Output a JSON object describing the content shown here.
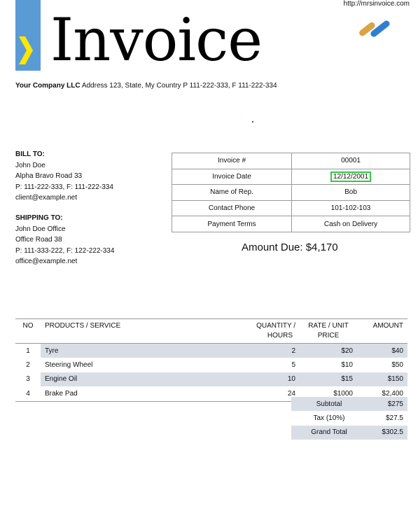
{
  "header": {
    "title": "Invoice",
    "url": "http://mrsinvoice.com",
    "company_name": "Your Company LLC",
    "company_details": "Address 123, State, My Country P 111-222-333, F 111-222-334"
  },
  "bill_to": {
    "heading": "BILL TO:",
    "name": "John Doe",
    "address": "Alpha Bravo Road 33",
    "phone": "P: 111-222-333, F: 111-222-334",
    "email": "client@example.net"
  },
  "ship_to": {
    "heading": "SHIPPING TO:",
    "name": "John Doe Office",
    "address": "Office Road 38",
    "phone": "P: 111-333-222, F: 122-222-334",
    "email": "office@example.net"
  },
  "info": [
    {
      "label": "Invoice #",
      "value": "00001"
    },
    {
      "label": "Invoice Date",
      "value": "12/12/2001"
    },
    {
      "label": "Name of Rep.",
      "value": "Bob"
    },
    {
      "label": "Contact Phone",
      "value": "101-102-103"
    },
    {
      "label": "Payment Terms",
      "value": "Cash on Delivery"
    }
  ],
  "amount_due": "Amount Due: $4,170",
  "items": {
    "headers": {
      "no": "NO",
      "product": "PRODUCTS / SERVICE",
      "qty_1": "QUANTITY /",
      "qty_2": "HOURS",
      "rate_1": "RATE / UNIT",
      "rate_2": "PRICE",
      "amount": "AMOUNT"
    },
    "rows": [
      {
        "no": "1",
        "product": "Tyre",
        "qty": "2",
        "rate": "$20",
        "amount": "$40"
      },
      {
        "no": "2",
        "product": "Steering Wheel",
        "qty": "5",
        "rate": "$10",
        "amount": "$50"
      },
      {
        "no": "3",
        "product": "Engine Oil",
        "qty": "10",
        "rate": "$15",
        "amount": "$150"
      },
      {
        "no": "4",
        "product": "Brake Pad",
        "qty": "24",
        "rate": "$1000",
        "amount": "$2,400"
      }
    ]
  },
  "totals": [
    {
      "label": "Subtotal",
      "value": "$275"
    },
    {
      "label": "Tax (10%)",
      "value": "$27.5"
    },
    {
      "label": "Grand Total",
      "value": "$302.5"
    }
  ],
  "colors": {
    "accent_bar": "#5b9bd5",
    "chevron": "#ffe600",
    "row_shade": "#d9dee6",
    "date_highlight": "#2ecc40"
  },
  "icons": {
    "chevron": "chevron-right-icon",
    "logo": "company-logo-icon"
  }
}
